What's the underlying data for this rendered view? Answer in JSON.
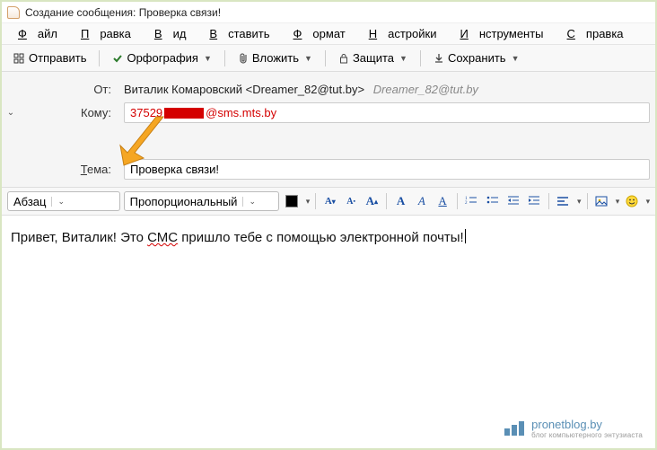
{
  "window": {
    "title": "Создание сообщения: Проверка связи!"
  },
  "menu": {
    "file": {
      "key": "Ф",
      "rest": "айл"
    },
    "edit": {
      "key": "П",
      "rest": "равка"
    },
    "view": {
      "key": "В",
      "rest": "ид"
    },
    "insert": {
      "key": "В",
      "rest": "ставить"
    },
    "format": {
      "key": "Ф",
      "rest": "ормат"
    },
    "settings": {
      "key": "Н",
      "rest": "астройки"
    },
    "tools": {
      "key": "И",
      "rest": "нструменты"
    },
    "help": {
      "key": "С",
      "rest": "правка"
    }
  },
  "toolbar": {
    "send": "Отправить",
    "spell": "Орфография",
    "attach": "Вложить",
    "security": "Защита",
    "save": "Сохранить"
  },
  "headers": {
    "from_label": "От:",
    "from_main": "Виталик Комаровский <Dreamer_82@tut.by>",
    "from_extra": "Dreamer_82@tut.by",
    "to_label": "Кому:",
    "to_prefix": "37529",
    "to_suffix": "@sms.mts.by",
    "subject_key": "Т",
    "subject_rest": "ема:",
    "subject_value": "Проверка связи!"
  },
  "format": {
    "paragraph": "Абзац",
    "font": "Пропорциональный"
  },
  "body": {
    "part1": "Привет, Виталик! Это ",
    "wavy": "СМС",
    "part2": " пришло тебе с помощью электронной почты!"
  },
  "watermark": {
    "main": "pronetblog.by",
    "sub": "блог компьютерного энтузиаста"
  }
}
